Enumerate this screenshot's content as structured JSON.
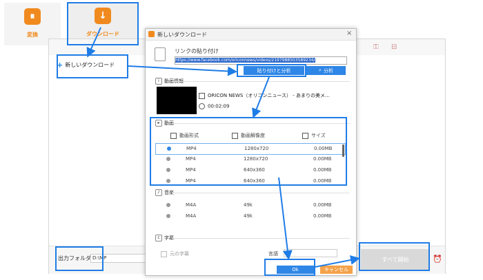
{
  "tiles": [
    {
      "label": "変換",
      "glyph": "⏸"
    },
    {
      "label": "ダウンロード",
      "glyph": "↓"
    }
  ],
  "main": {
    "new_download": "新しいダウンロード",
    "output_label": "出力フォルダ",
    "output_path": "D:\\MP",
    "start_button": "すべて開始",
    "alarm_icon": "⏰"
  },
  "dialog": {
    "title": "新しいダウンロード",
    "close": "×",
    "paste_label": "リンクの貼り付け",
    "url": "https://www.facebook.com/oriconnews/videos/2197988503589234/",
    "paste_analyze_button": "貼り付けと分析",
    "analyze_button": "分析",
    "video_info_header": "動画情報",
    "video_title": "ORICON NEWS（オリコンニュース） - あまりの美メ…",
    "video_duration": "00:02:09",
    "video_section_header": "動画",
    "columns": [
      "動画形式",
      "動画解像度",
      "サイズ"
    ],
    "video_rows": [
      {
        "format": "MP4",
        "resolution": "1280x720",
        "size": "0.00MB"
      },
      {
        "format": "MP4",
        "resolution": "1280x720",
        "size": "0.00MB"
      },
      {
        "format": "MP4",
        "resolution": "640x360",
        "size": "0.00MB"
      },
      {
        "format": "MP4",
        "resolution": "640x360",
        "size": "0.00MB"
      }
    ],
    "audio_section_header": "音楽",
    "audio_rows": [
      {
        "format": "M4A",
        "resolution": "49k",
        "size": "0.00MB"
      },
      {
        "format": "M4A",
        "resolution": "49k",
        "size": "0.00MB"
      }
    ],
    "subtitle_section_header": "字幕",
    "original_subtitle": "元の字幕",
    "language_label": "言語",
    "ok_button": "Ok",
    "cancel_button": "キャンセル"
  },
  "colors": {
    "accent": "#2e86e6",
    "callout": "#1e7ce6",
    "orange": "#f08a1e"
  }
}
